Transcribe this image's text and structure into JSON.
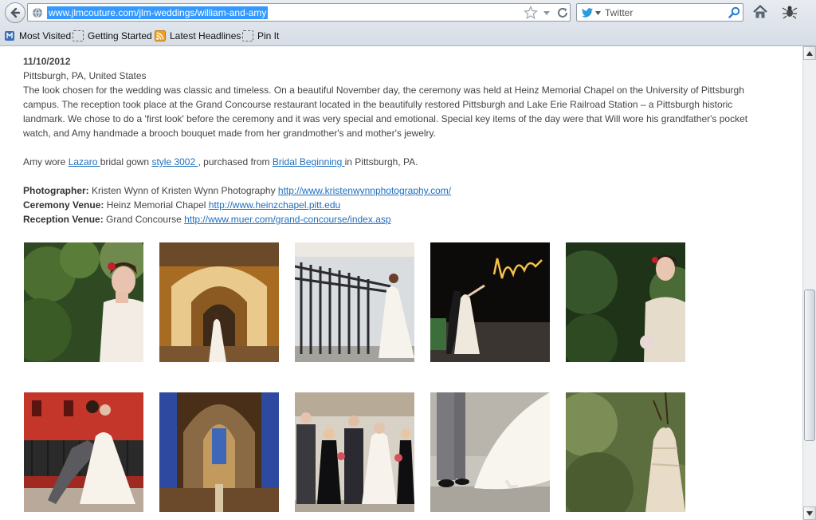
{
  "browser": {
    "url": "www.jlmcouture.com/jlm-weddings/william-and-amy",
    "search_engine": "Twitter",
    "bookmarks": [
      {
        "label": "Most Visited",
        "icon": "most-visited-icon"
      },
      {
        "label": "Getting Started",
        "icon": "page-icon"
      },
      {
        "label": "Latest Headlines",
        "icon": "rss-icon"
      },
      {
        "label": "Pin It",
        "icon": "page-icon"
      }
    ]
  },
  "article": {
    "date": "11/10/2012",
    "location": "Pittsburgh, PA, United States",
    "description": "The look chosen for the wedding was classic and timeless. On a beautiful November day, the ceremony was held at Heinz Memorial Chapel on the University of Pittsburgh campus. The reception took place at the Grand Concourse restaurant located in the beautifully restored Pittsburgh and Lake Erie Railroad Station – a Pittsburgh historic landmark. We chose to do a 'first look' before the ceremony and it was very special and emotional. Special key items of the day were that Will wore his grandfather's pocket watch, and Amy handmade a brooch bouquet made from her grandmother's and mother's jewelry.",
    "gown": {
      "prefix": "Amy wore ",
      "designer_link": "Lazaro ",
      "middle": "bridal gown ",
      "style_link": "style 3002 ",
      "middle2": ", purchased from ",
      "shop_link": "Bridal Beginning ",
      "suffix": "in Pittsburgh, PA."
    },
    "credits": [
      {
        "label": "Photographer:",
        "value": " Kristen Wynn of Kristen Wynn Photography  ",
        "link": "http://www.kristenwynnphotography.com/"
      },
      {
        "label": "Ceremony Venue:",
        "value": " Heinz Memorial Chapel  ",
        "link": "http://www.heinzchapel.pitt.edu"
      },
      {
        "label": "Reception Venue:",
        "value": " Grand Concourse  ",
        "link": "http://www.muer.com/grand-concourse/index.asp"
      }
    ]
  },
  "gallery_photos": [
    "bride-portrait-garden",
    "bride-church-archway",
    "bride-railing-bridge",
    "couple-sparkler-love",
    "bride-with-bouquet",
    "couple-dip-kiss",
    "chapel-interior",
    "wedding-party-group",
    "couple-shoes-detail",
    "gown-hanging-tree"
  ]
}
